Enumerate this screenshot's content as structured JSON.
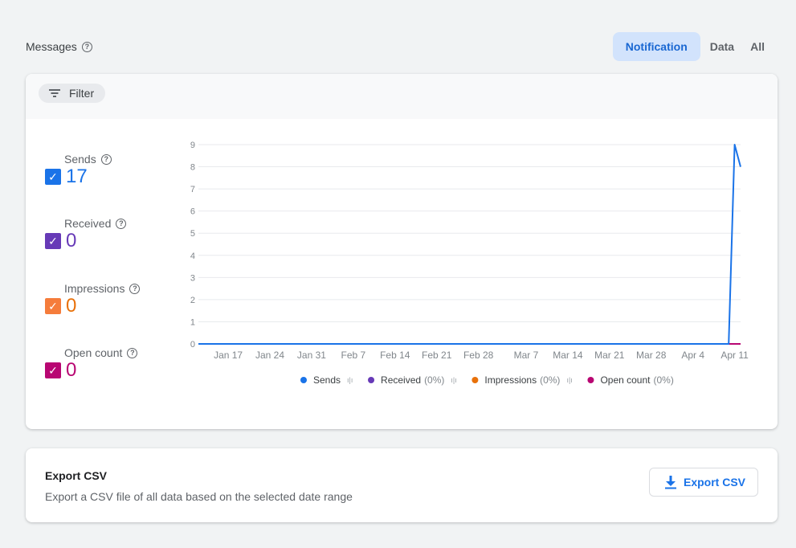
{
  "header": {
    "title": "Messages",
    "help_icon": "help-circle-icon",
    "tabs": [
      {
        "label": "Notification",
        "active": true
      },
      {
        "label": "Data",
        "active": false
      },
      {
        "label": "All",
        "active": false
      }
    ]
  },
  "filter": {
    "label": "Filter",
    "icon": "filter-list-icon"
  },
  "metrics": [
    {
      "label": "Sends",
      "value": "17",
      "color": "#1a73e8",
      "checked": true
    },
    {
      "label": "Received",
      "value": "0",
      "color": "#673ab7",
      "checked": true
    },
    {
      "label": "Impressions",
      "value": "0",
      "color": "#e8710a",
      "checked": true
    },
    {
      "label": "Open count",
      "value": "0",
      "color": "#b80672",
      "checked": true
    }
  ],
  "chart_data": {
    "type": "line",
    "x": [
      "Jan 17",
      "Jan 24",
      "Jan 31",
      "Feb 7",
      "Feb 14",
      "Feb 21",
      "Feb 28",
      "Mar 7",
      "Mar 14",
      "Mar 21",
      "Mar 28",
      "Apr 4",
      "Apr 11"
    ],
    "ylim": [
      0,
      9
    ],
    "yticks": [
      "0",
      "1",
      "2",
      "3",
      "4",
      "5",
      "6",
      "7",
      "8",
      "9"
    ],
    "grid": true,
    "legend_position": "bottom",
    "series": [
      {
        "name": "Sends",
        "legend_suffix": "",
        "color": "#1a73e8",
        "points": [
          [
            "Jan 12",
            0
          ],
          [
            "Apr 10",
            0
          ],
          [
            "Apr 11",
            9
          ],
          [
            "Apr 12",
            8
          ]
        ]
      },
      {
        "name": "Received",
        "legend_suffix": "(0%)",
        "color": "#673ab7",
        "points": [
          [
            "Jan 12",
            0
          ],
          [
            "Apr 12",
            0
          ]
        ]
      },
      {
        "name": "Impressions",
        "legend_suffix": "(0%)",
        "color": "#e8710a",
        "points": [
          [
            "Jan 12",
            0
          ],
          [
            "Apr 12",
            0
          ]
        ]
      },
      {
        "name": "Open count",
        "legend_suffix": "(0%)",
        "color": "#b80672",
        "points": [
          [
            "Jan 12",
            0
          ],
          [
            "Apr 12",
            0
          ]
        ]
      }
    ]
  },
  "export": {
    "title": "Export CSV",
    "description": "Export a CSV file of all data based on the selected date range",
    "button_label": "Export CSV",
    "button_icon": "download-icon"
  }
}
